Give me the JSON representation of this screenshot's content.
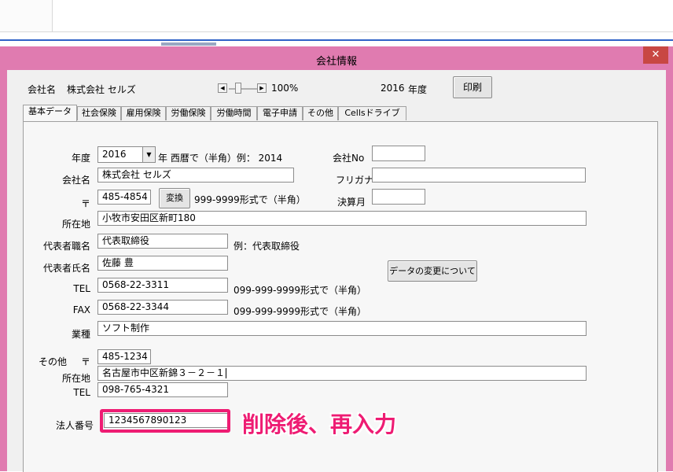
{
  "window": {
    "title": "会社情報",
    "close_glyph": "✕"
  },
  "header": {
    "company_label": "会社名",
    "company_value": "株式会社 セルズ",
    "zoom_value": "100%",
    "year_value": "2016",
    "year_label": "年度",
    "print_button": "印刷"
  },
  "tabs": [
    {
      "label": "基本データ",
      "active": true
    },
    {
      "label": "社会保険"
    },
    {
      "label": "雇用保険"
    },
    {
      "label": "労働保険"
    },
    {
      "label": "労働時間"
    },
    {
      "label": "電子申請"
    },
    {
      "label": "その他"
    },
    {
      "label": "Cellsドライブ"
    }
  ],
  "form": {
    "year_label": "年度",
    "year_value": "2016",
    "year_suffix": "年 西暦で（半角）例： 2014",
    "company_no_label": "会社No",
    "company_no_value": "",
    "company_name_label": "会社名",
    "company_name_value": "株式会社 セルズ",
    "furigana_label": "フリガナ",
    "furigana_value": "",
    "postal_label": "〒",
    "postal_value": "485-4854",
    "convert_button": "変換",
    "postal_hint": "999-9999形式で（半角）",
    "fiscal_month_label": "決算月",
    "fiscal_month_value": "",
    "address_label": "所在地",
    "address_value": "小牧市安田区新町180",
    "rep_title_label": "代表者職名",
    "rep_title_value": "代表取締役",
    "rep_title_hint": "例：代表取締役",
    "rep_name_label": "代表者氏名",
    "rep_name_value": "佐藤 豊",
    "data_change_button": "データの変更について",
    "tel_label": "TEL",
    "tel_value": "0568-22-3311",
    "tel_hint": "099-999-9999形式で（半角）",
    "fax_label": "FAX",
    "fax_value": "0568-22-3344",
    "fax_hint": "099-999-9999形式で（半角）",
    "industry_label": "業種",
    "industry_value": "ソフト制作",
    "other_label": "その他",
    "other_postal_label": "〒",
    "other_postal_value": "485-1234",
    "other_address_label": "所在地",
    "other_address_value": "名古屋市中区新錦３－２－１",
    "other_tel_label": "TEL",
    "other_tel_value": "098-765-4321",
    "corp_no_label": "法人番号",
    "corp_no_value": "1234567890123"
  },
  "annotation": {
    "text": "削除後、再入力",
    "color": "#ee1c73"
  },
  "colors": {
    "window_frame": "#e07bb0",
    "close_button": "#c84743"
  }
}
